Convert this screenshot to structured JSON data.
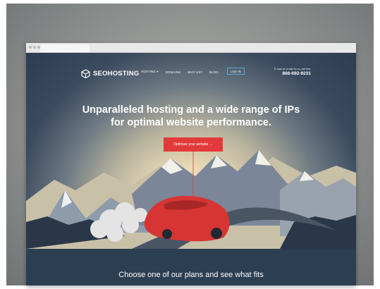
{
  "site": {
    "logo": "SEOHOSTING",
    "nav": [
      "HOSTING ▾",
      "DOMAINS",
      "WHY US?",
      "BLOG"
    ],
    "login": "LOG IN",
    "contact_line": "E-mail us or talk to us, toll free:",
    "phone": "866-692-9231"
  },
  "hero": {
    "headline_line1": "Unparalleled hosting and a wide range of IPs",
    "headline_line2": "for optimal website performance.",
    "cta": "Optimize your website →"
  },
  "plans": {
    "text": "Choose one of our plans and see what fits"
  },
  "colors": {
    "cta": "#e23a3a",
    "band": "#2c3e52",
    "login_border": "#5aa6d6"
  }
}
